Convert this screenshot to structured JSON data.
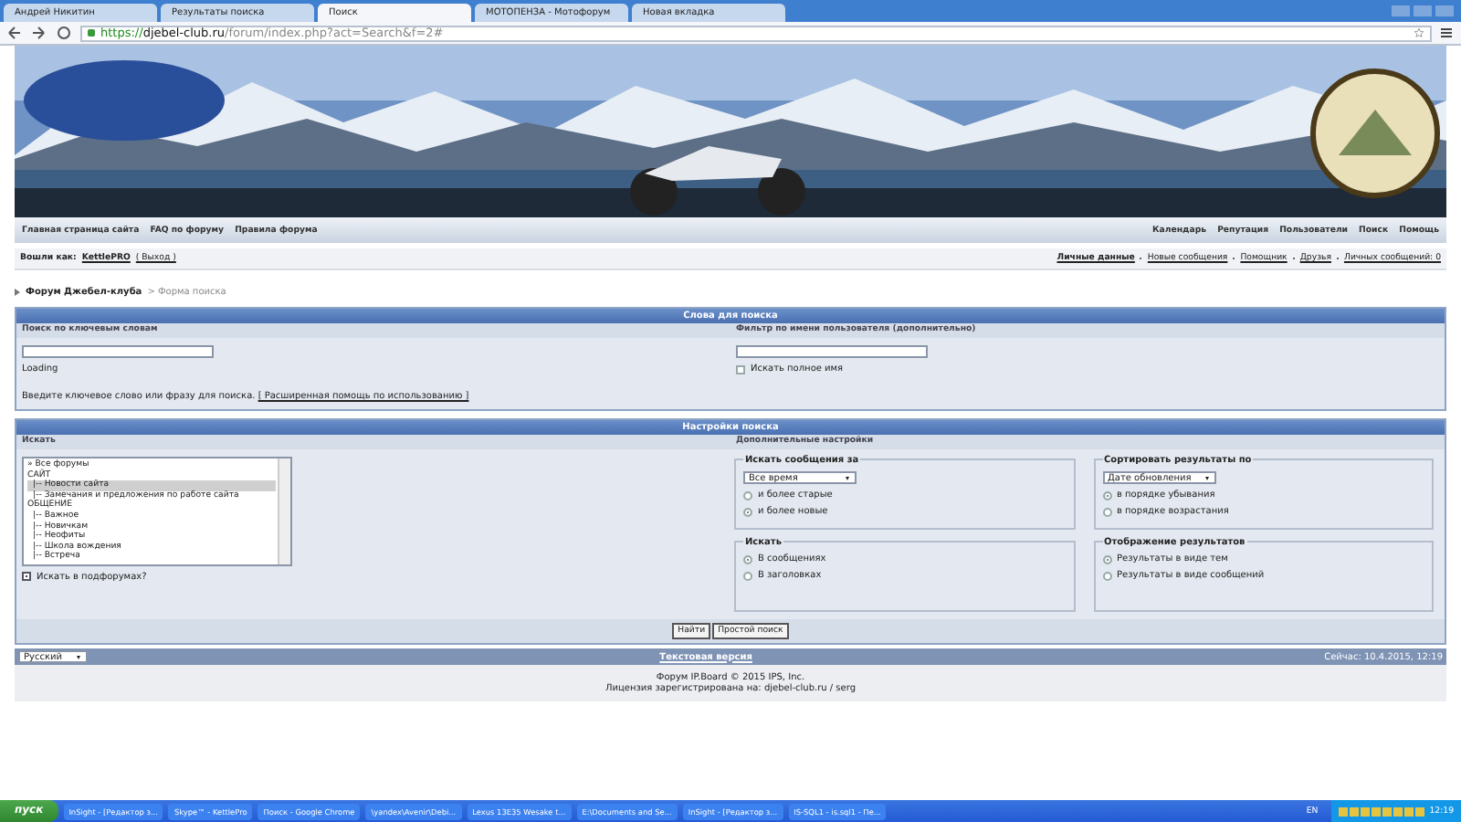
{
  "browser": {
    "tabs": [
      {
        "label": "Андрей Никитин",
        "selected": false
      },
      {
        "label": "Результаты поиска",
        "selected": false
      },
      {
        "label": "Поиск",
        "selected": true
      },
      {
        "label": "МОТОПЕНЗА - Мотофорум",
        "selected": false
      },
      {
        "label": "Новая вкладка",
        "selected": false
      }
    ],
    "address": {
      "scheme": "https://",
      "host": "djebel-club.ru",
      "path": "/forum/index.php?act=Search&f=2#"
    }
  },
  "nav": {
    "left": [
      "Главная страница сайта",
      "FAQ по форуму",
      "Правила форума"
    ],
    "right": [
      "Календарь",
      "Репутация",
      "Пользователи",
      "Поиск",
      "Помощь"
    ]
  },
  "user_bar": {
    "label": "Вошли как:",
    "user": "KettlePRO",
    "logout": "( Выход )",
    "links": [
      "Личные данные",
      "Новые сообщения",
      "Помощник",
      "Друзья",
      "Личных сообщений: 0"
    ]
  },
  "breadcrumb": {
    "root": "Форум Джебел-клуба",
    "current": "> Форма поиска"
  },
  "keywords_panel": {
    "title": "Слова для поиска",
    "keyword_label": "Поиск по ключевым словам",
    "loading": "Loading",
    "hint": "Введите ключевое слово или фразу для поиска.",
    "help_link": "[ Расширенная помощь по использованию ]",
    "user_label": "Фильтр по имени пользователя (дополнительно)",
    "full_name": {
      "label": "Искать полное имя",
      "checked": false
    }
  },
  "settings_panel": {
    "title": "Настройки поиска",
    "left_label": "Искать",
    "right_label": "Дополнительные настройки",
    "forums": [
      {
        "label": "» Все форумы",
        "selected": false
      },
      {
        "label": "САЙТ",
        "selected": false,
        "children": [
          {
            "label": "|-- Новости сайта",
            "selected": true
          },
          {
            "label": "|-- Замечания и предложения по работе сайта",
            "selected": false
          }
        ]
      },
      {
        "label": "ОБЩЕНИЕ",
        "selected": false,
        "children": [
          {
            "label": "|-- Важное",
            "selected": false
          },
          {
            "label": "|-- Новичкам",
            "selected": false
          },
          {
            "label": "|-- Неофиты",
            "selected": false
          },
          {
            "label": "|-- Школа вождения",
            "selected": false
          },
          {
            "label": "|-- Встреча",
            "selected": false
          }
        ]
      }
    ],
    "subforums": {
      "label": "Искать в подфорумах?",
      "checked": true
    },
    "groups": [
      {
        "title": "Искать сообщения за",
        "select": "Все время",
        "options": [
          {
            "label": "и более старые",
            "selected": false
          },
          {
            "label": "и более новые",
            "selected": true
          }
        ]
      },
      {
        "title": "Сортировать результаты по",
        "select": "Дате обновления",
        "options": [
          {
            "label": "в порядке убывания",
            "selected": true
          },
          {
            "label": "в порядке возрастания",
            "selected": false
          }
        ]
      },
      {
        "title": "Искать",
        "options": [
          {
            "label": "В сообщениях",
            "selected": true
          },
          {
            "label": "В заголовках",
            "selected": false
          }
        ]
      },
      {
        "title": "Отображение результатов",
        "options": [
          {
            "label": "Результаты в виде тем",
            "selected": true
          },
          {
            "label": "Результаты в виде сообщений",
            "selected": false
          }
        ]
      }
    ],
    "buttons": [
      "Найти",
      "Простой поиск"
    ]
  },
  "footer": {
    "language": "Русский",
    "text_version": "Текстовая версия",
    "now": "Сейчас: 10.4.2015, 12:19",
    "copyright": "Форум IP.Board © 2015  IPS, Inc.",
    "license": "Лицензия зарегистрирована на: djebel-club.ru / serg"
  },
  "taskbar": {
    "start": "пуск",
    "items": [
      "InSight - [Редактор з...",
      "Skype™ - KettlePro",
      "Поиск - Google Chrome",
      "\\yandex\\Avenir\\Debi...",
      "Lexus 13E35 Wesake t...",
      "E:\\Documents and Se...",
      "InSight - [Редактор з...",
      "IS-SQL1 - is.sql1 - Пе..."
    ],
    "language": "EN",
    "clock": "12:19"
  }
}
